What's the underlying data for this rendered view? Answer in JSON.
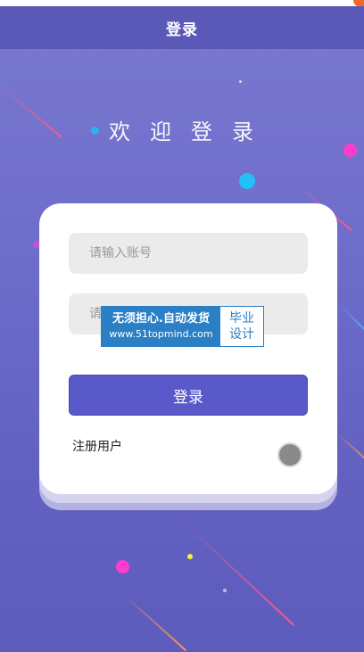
{
  "header": {
    "title": "登录"
  },
  "welcome": {
    "text": "欢迎登录"
  },
  "form": {
    "account_placeholder": "请输入账号",
    "password_placeholder": "请输入密码",
    "login_button": "登录",
    "register_link": "注册用户"
  },
  "watermark": {
    "line1": "无须担心.自动发货",
    "line2": "www.51topmind.com",
    "right_top": "毕业",
    "right_bottom": "设计"
  },
  "colors": {
    "header_bg": "#5a59b8",
    "background": "#6f6ecb",
    "button": "#5a59c9",
    "input_bg": "#ebebeb",
    "watermark_blue": "#2b7fc4"
  }
}
